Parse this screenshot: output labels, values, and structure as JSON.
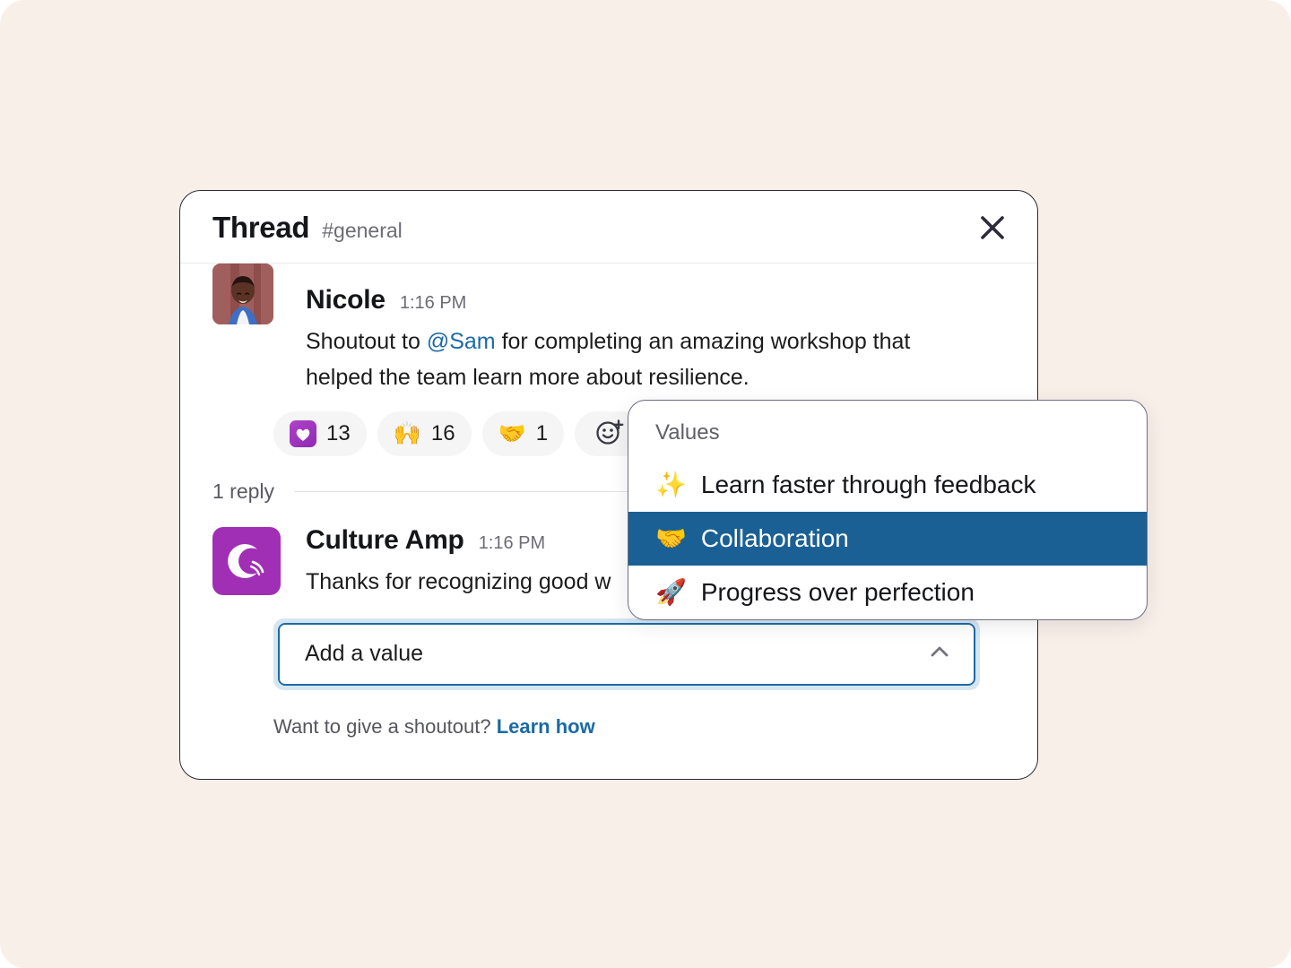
{
  "theme": {
    "page_background": "#f8efe9",
    "card_background": "#ffffff",
    "link_color": "#1b6aa5",
    "selected_option_background": "#1a6094",
    "brand_purple": "#a12fb5",
    "focus_ring": "#d6e5f2"
  },
  "header": {
    "title": "Thread",
    "channel": "#general",
    "close_icon": "close-icon"
  },
  "root_message": {
    "author": "Nicole",
    "time": "1:16 PM",
    "avatar": "nicole-photo-avatar",
    "text_before_mention": "Shoutout to ",
    "mention": "@Sam",
    "text_after_mention": " for completing an amazing workshop that helped the team learn more about resilience."
  },
  "reactions": [
    {
      "emoji": "culture-amp-heart",
      "count": "13"
    },
    {
      "emoji": "🙌",
      "count": "16"
    },
    {
      "emoji": "🤝",
      "count": "1"
    }
  ],
  "add_reaction": {
    "icon": "add-reaction-icon"
  },
  "replies": {
    "count_label": "1 reply",
    "items": [
      {
        "author": "Culture Amp",
        "time": "1:16 PM",
        "avatar": "culture-amp-logo",
        "text": "Thanks for recognizing good w"
      }
    ]
  },
  "value_select": {
    "label": "Add a value",
    "chevron_icon": "chevron-up-icon",
    "expanded": true
  },
  "footer": {
    "prompt": "Want to give a shoutout?",
    "link_label": "Learn how"
  },
  "values_dropdown": {
    "header": "Values",
    "options": [
      {
        "emoji": "✨",
        "label": "Learn faster through feedback",
        "selected": false
      },
      {
        "emoji": "🤝",
        "label": "Collaboration",
        "selected": true
      },
      {
        "emoji": "🚀",
        "label": "Progress over perfection",
        "selected": false
      }
    ]
  }
}
